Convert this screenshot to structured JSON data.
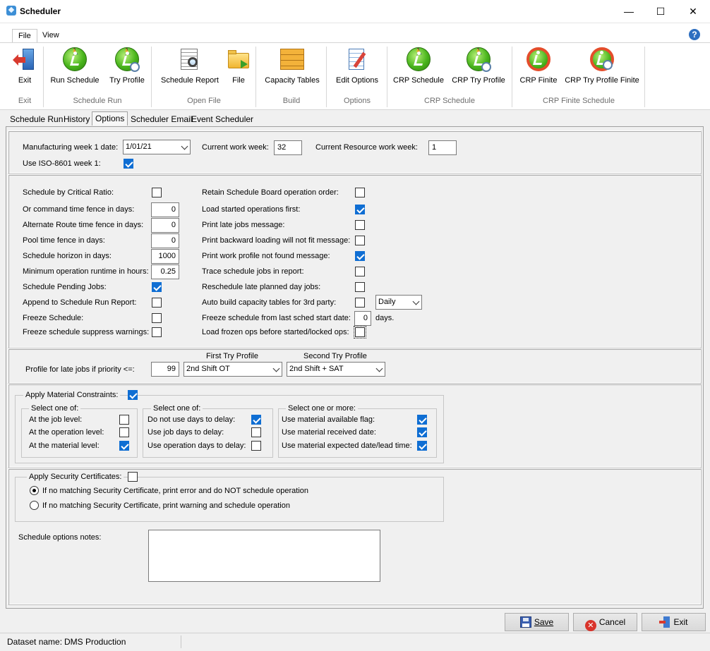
{
  "window": {
    "title": "Scheduler",
    "minimize": "—",
    "maximize": "☐",
    "close": "✕"
  },
  "menu": {
    "file": "File",
    "view": "View",
    "help": "?"
  },
  "ribbon": {
    "exit": "Exit",
    "run_schedule": "Run Schedule",
    "try_profile": "Try Profile",
    "schedule_report": "Schedule Report",
    "file": "File",
    "capacity_tables": "Capacity Tables",
    "edit_options": "Edit Options",
    "crp_schedule": "CRP Schedule",
    "crp_try_profile": "CRP Try Profile",
    "crp_finite": "CRP Finite",
    "crp_try_profile_finite": "CRP Try Profile Finite",
    "groups": {
      "exit": "Exit",
      "schedule_run": "Schedule Run",
      "open_file": "Open File",
      "build": "Build",
      "options": "Options",
      "crp_schedule": "CRP Schedule",
      "crp_finite_schedule": "CRP Finite Schedule"
    }
  },
  "tabs": [
    "Schedule Run",
    "History",
    "Options",
    "Scheduler Email",
    "Event Scheduler"
  ],
  "week": {
    "mfg_week_label": "Manufacturing week 1 date:",
    "mfg_week_value": "1/01/21",
    "current_week_label": "Current work week:",
    "current_week_value": "32",
    "resource_week_label": "Current Resource work week:",
    "resource_week_value": "1",
    "iso_label": "Use ISO-8601 week 1:",
    "iso_checked": true
  },
  "left_opts": {
    "critical_ratio": {
      "label": "Schedule by Critical Ratio:",
      "checked": false
    },
    "or_fence": {
      "label": "Or command time fence in days:",
      "value": "0"
    },
    "alt_fence": {
      "label": "Alternate Route time fence in days:",
      "value": "0"
    },
    "pool_fence": {
      "label": "Pool time fence in days:",
      "value": "0"
    },
    "horizon": {
      "label": "Schedule horizon in days:",
      "value": "1000"
    },
    "min_runtime": {
      "label": "Minimum operation runtime in hours:",
      "value": "0.25"
    },
    "pending": {
      "label": "Schedule Pending Jobs:",
      "checked": true
    },
    "append": {
      "label": "Append to Schedule Run Report:",
      "checked": false
    },
    "freeze": {
      "label": "Freeze Schedule:",
      "checked": false
    },
    "freeze_suppress": {
      "label": "Freeze schedule suppress warnings:",
      "checked": false
    }
  },
  "right_opts": {
    "retain_order": {
      "label": "Retain Schedule Board operation order:",
      "checked": false
    },
    "load_started": {
      "label": "Load started operations first:",
      "checked": true
    },
    "print_late": {
      "label": "Print late jobs message:",
      "checked": false
    },
    "print_backward": {
      "label": "Print backward loading will not fit message:",
      "checked": false
    },
    "print_profile": {
      "label": "Print work profile not found message:",
      "checked": true
    },
    "trace": {
      "label": "Trace schedule jobs in report:",
      "checked": false
    },
    "reschedule_late": {
      "label": "Reschedule late planned day jobs:",
      "checked": false
    },
    "auto_build": {
      "label": "Auto build capacity tables for 3rd party:",
      "checked": false,
      "freq": "Daily"
    },
    "freeze_from": {
      "label": "Freeze schedule from last sched start date:",
      "value": "0",
      "suffix": "days."
    },
    "load_frozen": {
      "label": "Load frozen ops before started/locked ops:",
      "checked": false
    }
  },
  "profile": {
    "late_label": "Profile for late jobs if priority <=:",
    "priority": "99",
    "first_label": "First Try Profile",
    "first_value": "2nd Shift OT",
    "second_label": "Second Try Profile",
    "second_value": "2nd Shift + SAT"
  },
  "material": {
    "apply_label": "Apply Material Constraints:",
    "apply_checked": true,
    "g1_title": "Select one of:",
    "g1": [
      {
        "label": "At the job level:",
        "checked": false
      },
      {
        "label": "At the operation level:",
        "checked": false
      },
      {
        "label": "At the material level:",
        "checked": true
      }
    ],
    "g2_title": "Select one of:",
    "g2": [
      {
        "label": "Do not use days to delay:",
        "checked": true
      },
      {
        "label": "Use job days to delay:",
        "checked": false
      },
      {
        "label": "Use operation days to delay:",
        "checked": false
      }
    ],
    "g3_title": "Select one or more:",
    "g3": [
      {
        "label": "Use material available flag:",
        "checked": true
      },
      {
        "label": "Use material received date:",
        "checked": true
      },
      {
        "label": "Use material expected date/lead time:",
        "checked": true
      }
    ]
  },
  "security": {
    "apply_label": "Apply Security Certificates:",
    "apply_checked": false,
    "radio1": "If no matching Security Certificate, print error and do NOT schedule operation",
    "radio2": "If no matching Security Certificate, print warning and schedule operation",
    "selected": 1
  },
  "notes": {
    "label": "Schedule options notes:",
    "value": ""
  },
  "buttons": {
    "save": "Save",
    "cancel": "Cancel",
    "exit": "Exit"
  },
  "status": {
    "dataset_label": "Dataset name:",
    "dataset_value": "DMS Production"
  },
  "colors": {
    "check_blue": "#0f6ed3",
    "ribbon_green": "#49b51c"
  }
}
